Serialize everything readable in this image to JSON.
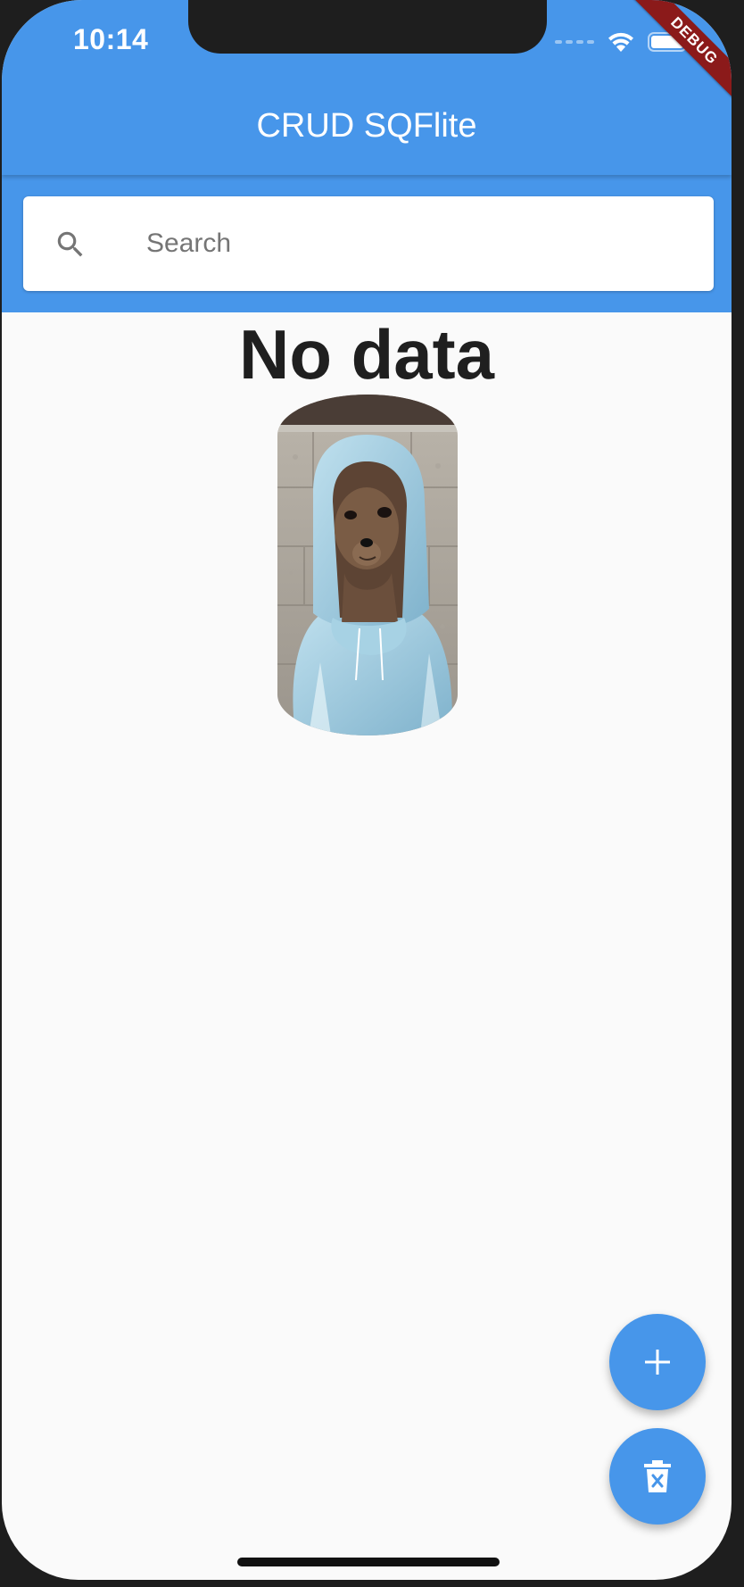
{
  "status_bar": {
    "time": "10:14"
  },
  "debug_banner": {
    "label": "DEBUG"
  },
  "app_bar": {
    "title": "CRUD SQFlite",
    "color": "#4796ea"
  },
  "search": {
    "placeholder": "Search",
    "value": "",
    "icon": "search-icon"
  },
  "empty_state": {
    "message": "No data",
    "image": "dog-in-hoodie-photo"
  },
  "fabs": {
    "add": {
      "icon": "plus-icon"
    },
    "delete_all": {
      "icon": "trash-icon"
    }
  }
}
